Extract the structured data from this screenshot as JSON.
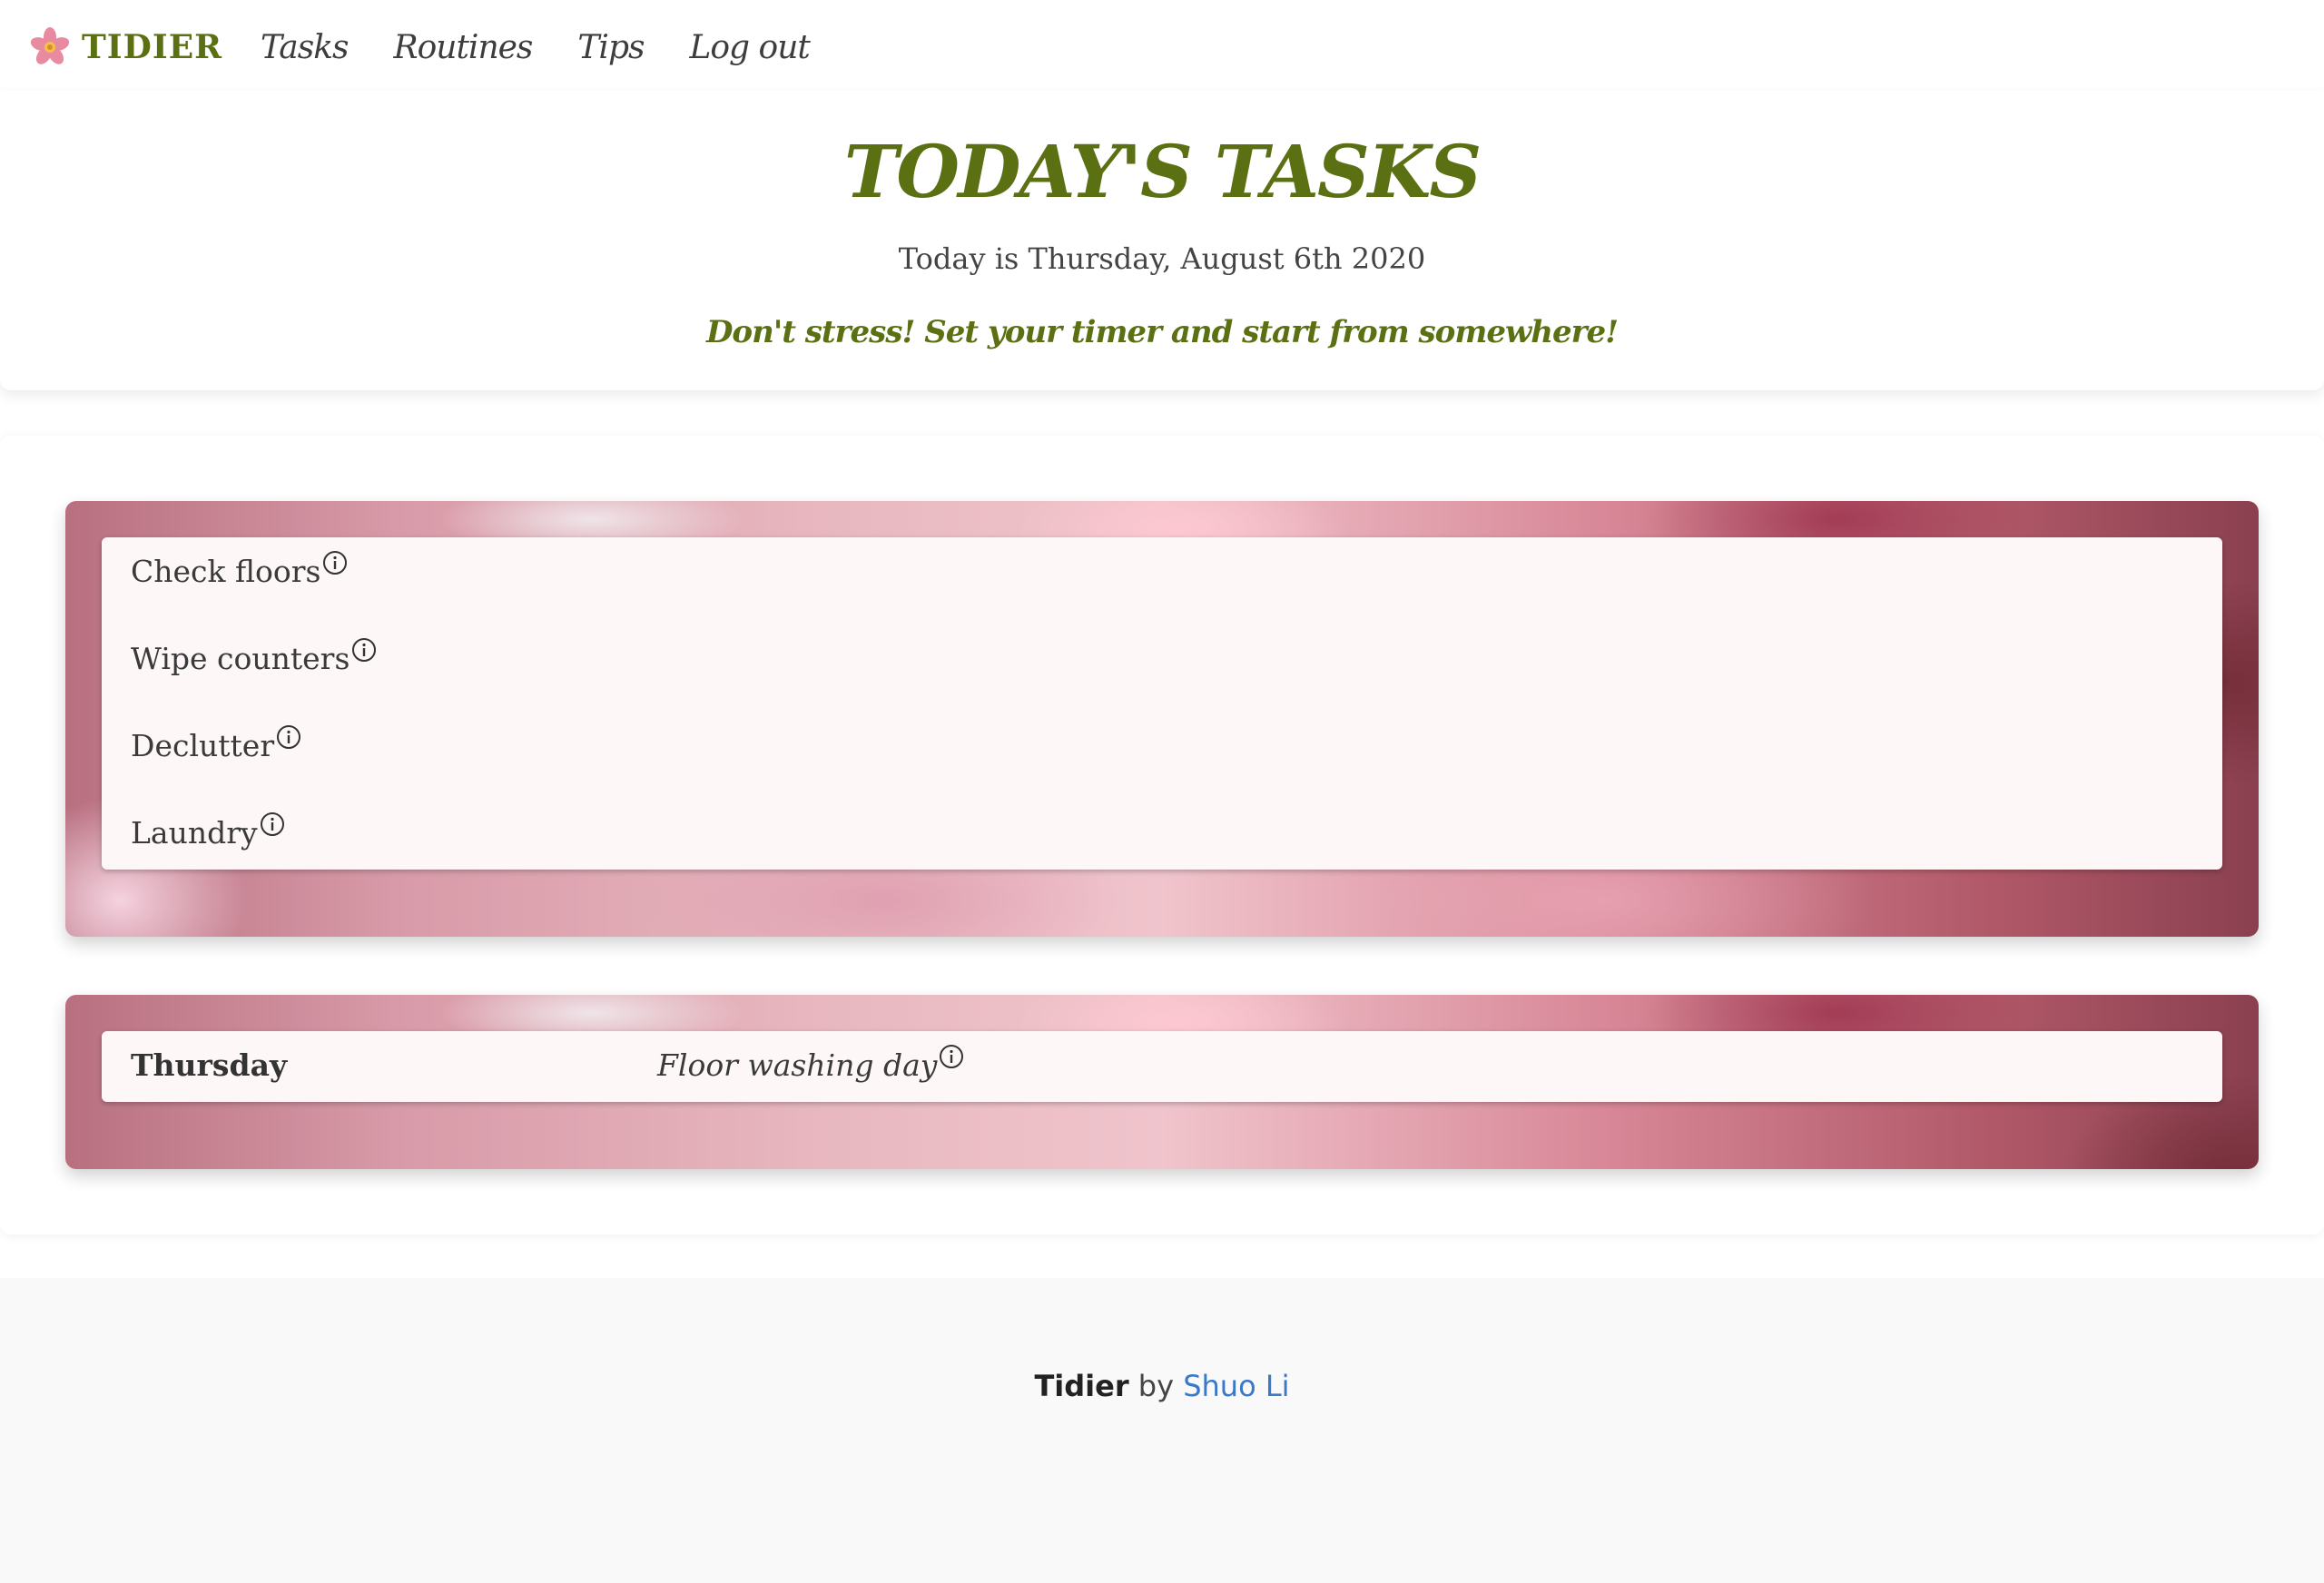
{
  "navbar": {
    "brand": "TIDIER",
    "links": [
      "Tasks",
      "Routines",
      "Tips",
      "Log out"
    ]
  },
  "header": {
    "title": "TODAY'S TASKS",
    "date_line": "Today is Thursday, August 6th 2020",
    "motto": "Don't stress! Set your timer and start from somewhere!"
  },
  "tasks": [
    "Check floors",
    "Wipe counters",
    "Declutter",
    "Laundry"
  ],
  "routine": {
    "day": "Thursday",
    "task": "Floor washing day"
  },
  "footer": {
    "brand": "Tidier",
    "by": "by",
    "author": "Shuo Li"
  },
  "colors": {
    "brand_green": "#5b7012",
    "link_blue": "#3a78c9"
  },
  "icons": {
    "brand": "flower-icon",
    "task_info": "info-icon"
  }
}
